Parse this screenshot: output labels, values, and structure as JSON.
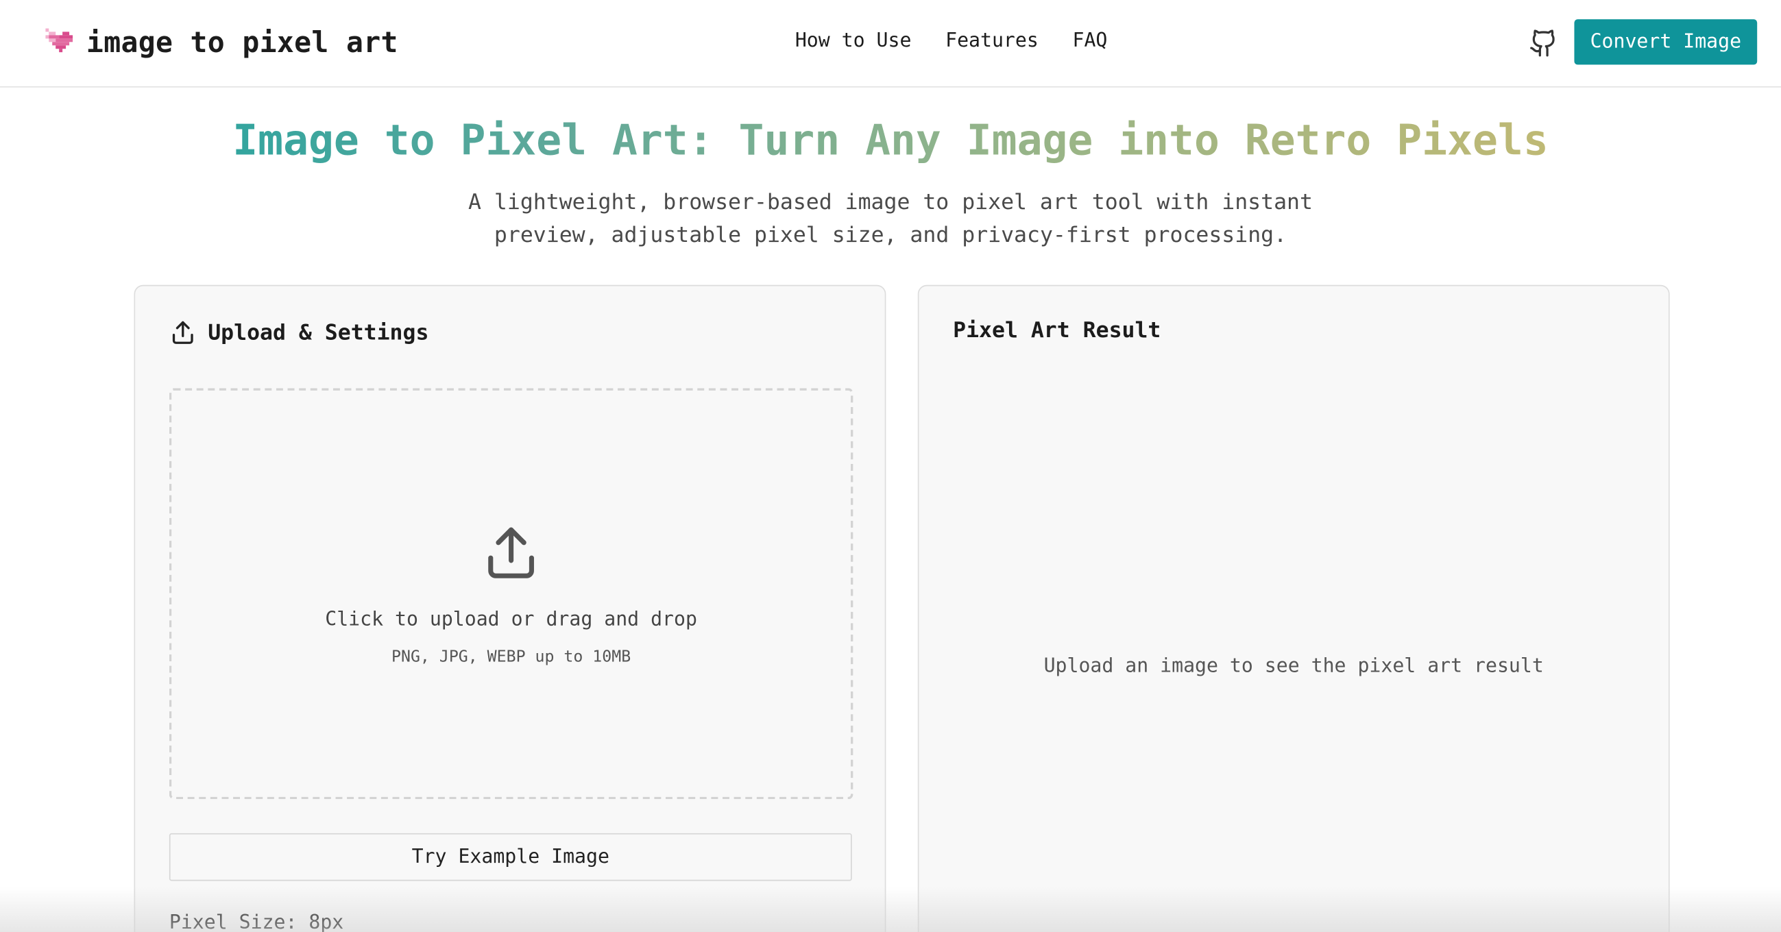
{
  "brand": {
    "name": "image to pixel art",
    "logo_icon": "pixel-heart-icon",
    "logo_colors": [
      "#f3b1cf",
      "#e26aa0",
      "#d94b8c"
    ]
  },
  "nav": {
    "items": [
      "How to Use",
      "Features",
      "FAQ"
    ]
  },
  "header_actions": {
    "github_icon": "github-icon",
    "convert_label": "Convert Image",
    "accent": "#0f949a"
  },
  "hero": {
    "title_words": [
      "Image",
      "to",
      "Pixel",
      "Art:",
      "Turn",
      "Any",
      "Image",
      "into",
      "Retro",
      "Pixels"
    ],
    "title_gradient": [
      "#13a2a2",
      "#d1bb6c"
    ],
    "subtitle_line1": "A lightweight, browser-based image to pixel art tool with instant",
    "subtitle_line2": "preview, adjustable pixel size, and privacy-first processing."
  },
  "upload_panel": {
    "icon": "upload-icon",
    "title": "Upload & Settings",
    "dropzone": {
      "icon": "upload-icon",
      "main_text": "Click to upload or drag and drop",
      "sub_text": "PNG, JPG, WEBP up to 10MB"
    },
    "example_button": "Try Example Image",
    "pixel_size_label": "Pixel Size: 8px"
  },
  "result_panel": {
    "title": "Pixel Art Result",
    "empty_text": "Upload an image to see the pixel art result"
  }
}
